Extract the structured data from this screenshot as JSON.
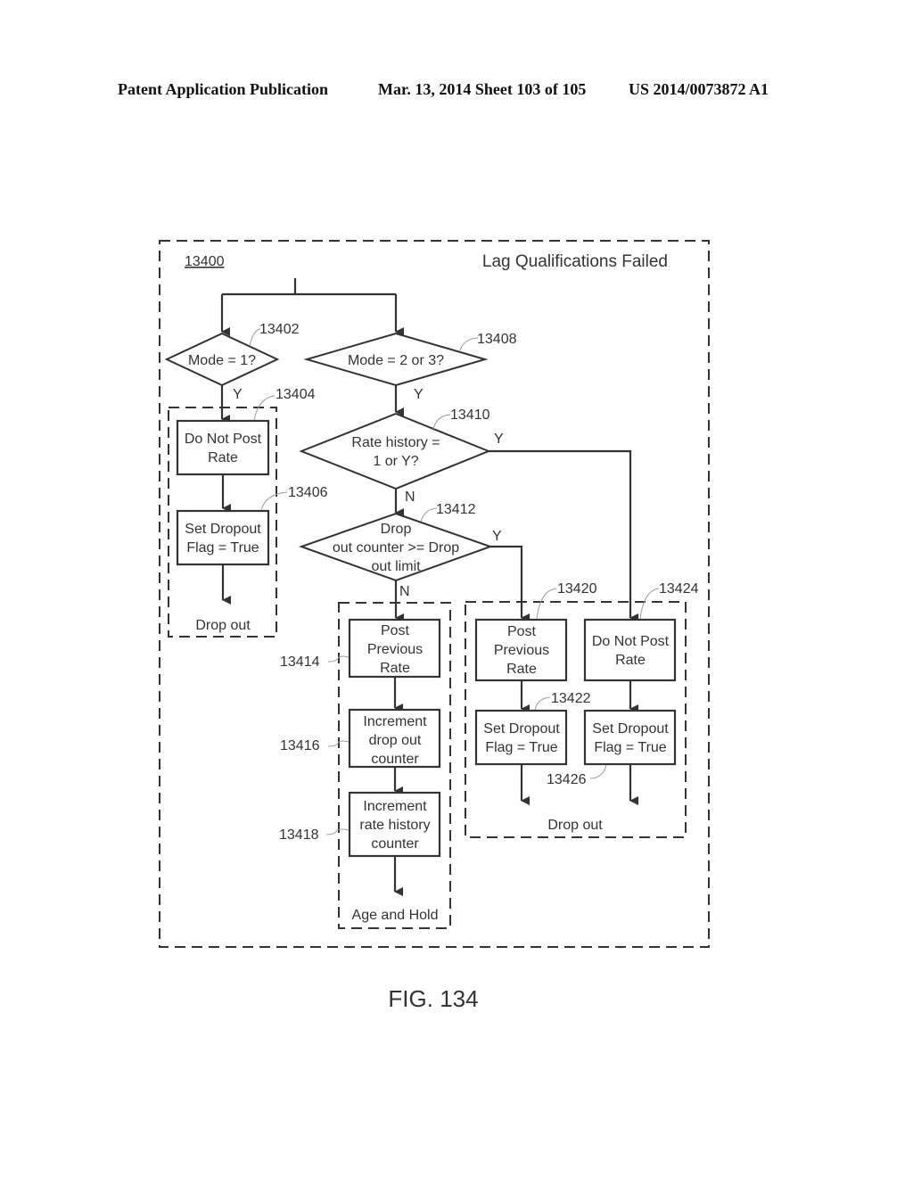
{
  "header": {
    "left": "Patent Application Publication",
    "date_sheet": "Mar. 13, 2014  Sheet 103 of 105",
    "pub_number": "US 2014/0073872 A1"
  },
  "diagram": {
    "ref": "13400",
    "title": "Lag Qualifications Failed",
    "decisions": {
      "d13402": {
        "ref": "13402",
        "lines": [
          "Mode = 1?"
        ]
      },
      "d13408": {
        "ref": "13408",
        "lines": [
          "Mode = 2 or 3?"
        ]
      },
      "d13410": {
        "ref": "13410",
        "lines": [
          "Rate history =",
          "1 or Y?"
        ]
      },
      "d13412": {
        "ref": "13412",
        "lines": [
          "Drop",
          "out counter >= Drop",
          "out limit"
        ]
      }
    },
    "processes": {
      "p13404": {
        "ref": "13404",
        "lines": [
          "Do Not Post",
          "Rate"
        ]
      },
      "p13406": {
        "ref": "13406",
        "lines": [
          "Set Dropout",
          "Flag = True"
        ]
      },
      "p13414": {
        "ref": "13414",
        "lines": [
          "Post",
          "Previous",
          "Rate"
        ]
      },
      "p13416": {
        "ref": "13416",
        "lines": [
          "Increment",
          "drop out",
          "counter"
        ]
      },
      "p13418": {
        "ref": "13418",
        "lines": [
          "Increment",
          "rate history",
          "counter"
        ]
      },
      "p13420": {
        "ref": "13420",
        "lines": [
          "Post",
          "Previous",
          "Rate"
        ]
      },
      "p13422": {
        "ref": "13422",
        "lines": [
          "Set Dropout",
          "Flag = True"
        ]
      },
      "p13424": {
        "ref": "13424",
        "lines": [
          "Do Not Post",
          "Rate"
        ]
      },
      "p13426": {
        "ref": "13426",
        "lines": [
          "Set Dropout",
          "Flag = True"
        ]
      }
    },
    "groups": {
      "left_dropout": "Drop out",
      "age_and_hold": "Age and Hold",
      "right_dropout": "Drop out"
    },
    "edge_labels": {
      "yes": "Y",
      "no": "N"
    }
  },
  "figure_label": "FIG. 134"
}
